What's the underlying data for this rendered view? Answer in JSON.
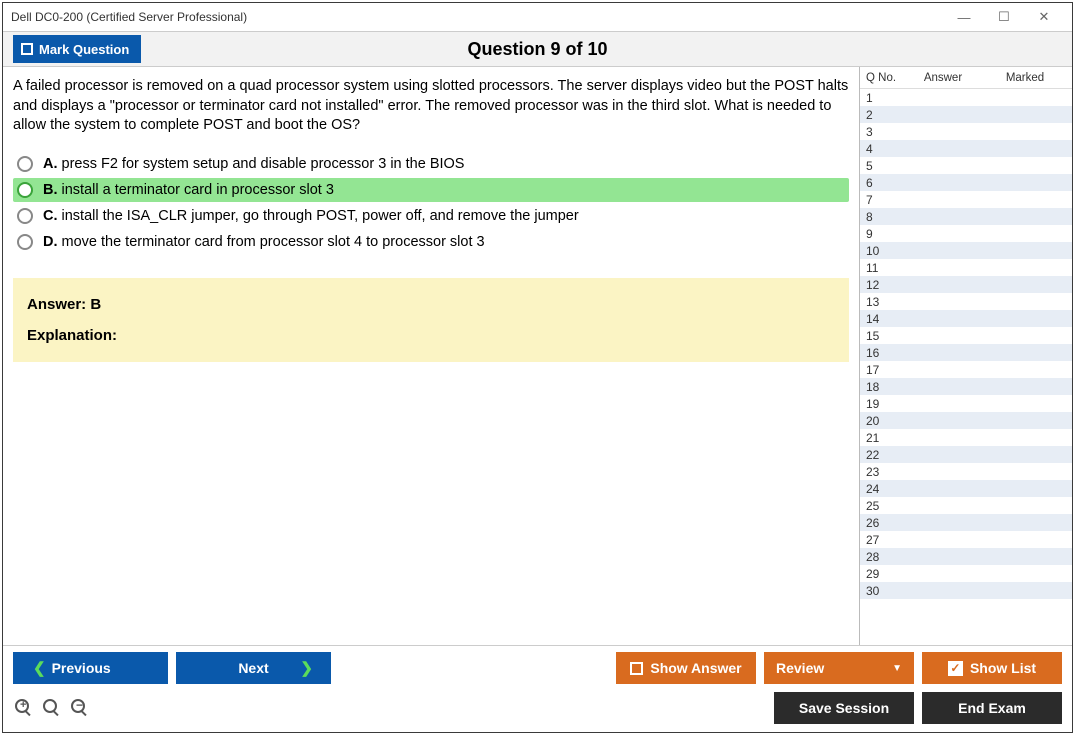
{
  "window": {
    "title": "Dell DC0-200 (Certified Server Professional)"
  },
  "header": {
    "mark_label": "Mark Question",
    "question_title": "Question 9 of 10"
  },
  "question": {
    "text": "A failed processor is removed on a quad processor system using slotted processors. The server displays video but the POST halts and displays a \"processor or terminator card not installed\" error. The removed processor was in the third slot. What is needed to allow the system to complete POST and boot the OS?",
    "options": [
      {
        "letter": "A.",
        "text": "press F2 for system setup and disable processor 3 in the BIOS",
        "correct": false
      },
      {
        "letter": "B.",
        "text": "install a terminator card in processor slot 3",
        "correct": true
      },
      {
        "letter": "C.",
        "text": "install the ISA_CLR jumper, go through POST, power off, and remove the jumper",
        "correct": false
      },
      {
        "letter": "D.",
        "text": "move the terminator card from processor slot 4 to processor slot 3",
        "correct": false
      }
    ]
  },
  "answer_panel": {
    "answer_label": "Answer: ",
    "answer_value": "B",
    "explanation_label": "Explanation:",
    "explanation_text": ""
  },
  "sidebar": {
    "headers": {
      "qno": "Q No.",
      "answer": "Answer",
      "marked": "Marked"
    },
    "rows": [
      {
        "q": "1"
      },
      {
        "q": "2"
      },
      {
        "q": "3"
      },
      {
        "q": "4"
      },
      {
        "q": "5"
      },
      {
        "q": "6"
      },
      {
        "q": "7"
      },
      {
        "q": "8"
      },
      {
        "q": "9"
      },
      {
        "q": "10"
      },
      {
        "q": "11"
      },
      {
        "q": "12"
      },
      {
        "q": "13"
      },
      {
        "q": "14"
      },
      {
        "q": "15"
      },
      {
        "q": "16"
      },
      {
        "q": "17"
      },
      {
        "q": "18"
      },
      {
        "q": "19"
      },
      {
        "q": "20"
      },
      {
        "q": "21"
      },
      {
        "q": "22"
      },
      {
        "q": "23"
      },
      {
        "q": "24"
      },
      {
        "q": "25"
      },
      {
        "q": "26"
      },
      {
        "q": "27"
      },
      {
        "q": "28"
      },
      {
        "q": "29"
      },
      {
        "q": "30"
      }
    ]
  },
  "footer": {
    "previous": "Previous",
    "next": "Next",
    "show_answer": "Show Answer",
    "review": "Review",
    "show_list": "Show List",
    "save_session": "Save Session",
    "end_exam": "End Exam"
  }
}
